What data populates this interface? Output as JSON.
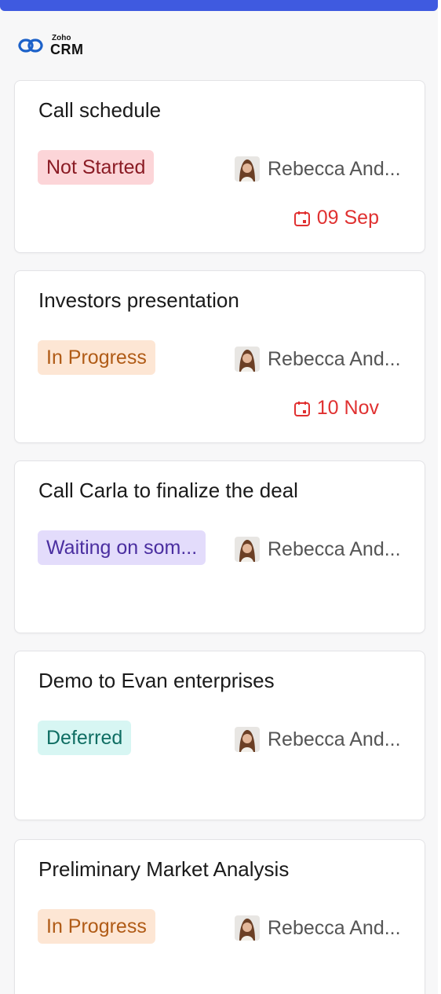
{
  "app": {
    "brand_small": "Zoho",
    "brand_big": "CRM"
  },
  "colors": {
    "accent_bar": "#3f5ae0",
    "due_red": "#e03131"
  },
  "tasks": [
    {
      "title": "Call schedule",
      "status": "Not Started",
      "status_colors": {
        "bg": "#fcd5d8",
        "fg": "#8a1b24"
      },
      "owner": "Rebecca And...",
      "due": "09 Sep"
    },
    {
      "title": "Investors presentation",
      "status": "In Progress",
      "status_colors": {
        "bg": "#fde6d4",
        "fg": "#b05b16"
      },
      "owner": "Rebecca And...",
      "due": "10 Nov"
    },
    {
      "title": "Call Carla to finalize the deal",
      "status": "Waiting on som...",
      "status_colors": {
        "bg": "#e3dcfb",
        "fg": "#4a2ea0"
      },
      "owner": "Rebecca And...",
      "due": ""
    },
    {
      "title": "Demo to Evan enterprises",
      "status": "Deferred",
      "status_colors": {
        "bg": "#d7f6f3",
        "fg": "#0f6e63"
      },
      "owner": "Rebecca And...",
      "due": ""
    },
    {
      "title": "Preliminary Market Analysis",
      "status": "In Progress",
      "status_colors": {
        "bg": "#fde6d4",
        "fg": "#b05b16"
      },
      "owner": "Rebecca And...",
      "due": ""
    }
  ]
}
